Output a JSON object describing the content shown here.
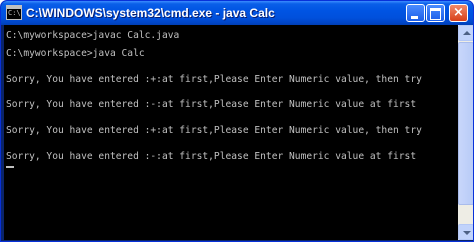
{
  "window": {
    "title": "C:\\WINDOWS\\system32\\cmd.exe - java Calc",
    "icon": "cmd-icon",
    "icon_prompt": "C:\\",
    "buttons": [
      "minimize",
      "maximize",
      "close"
    ],
    "close_glyph": "×"
  },
  "console": {
    "lines": [
      "C:\\myworkspace>javac Calc.java",
      "",
      "C:\\myworkspace>java Calc",
      "",
      "Sorry, You have entered :+:at first,Please Enter Numeric value, then try",
      "",
      "Sorry, You have entered :-:at first,Please Enter Numeric value at first",
      "",
      "Sorry, You have entered :+:at first,Please Enter Numeric value, then try",
      "",
      "Sorry, You have entered :-:at first,Please Enter Numeric value at first"
    ]
  },
  "colors": {
    "titlebar": "#0054e3",
    "console_bg": "#000000",
    "console_text": "#c0c0c0",
    "close_button": "#d8401a"
  }
}
